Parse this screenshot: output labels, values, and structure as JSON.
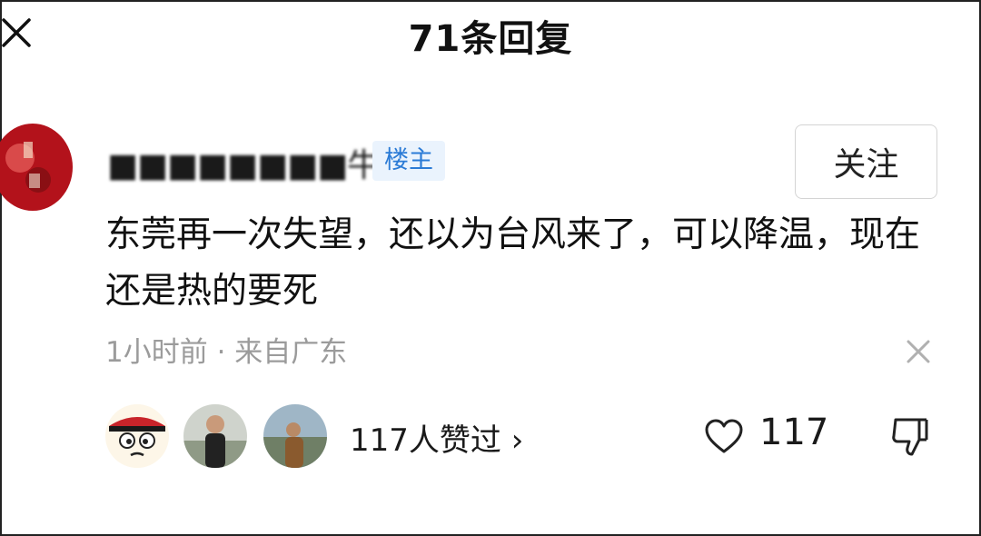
{
  "header": {
    "title": "71条回复",
    "close_icon": "close-icon"
  },
  "comment": {
    "username": "■■■■■■■■牛",
    "op_badge": "楼主",
    "follow_label": "关注",
    "text": "东莞再一次失望，还以为台风来了，可以降温，现在还是热的要死",
    "meta": "1小时前 · 来自广东",
    "likers_label": "117人赞过 ›",
    "like_count": "117"
  },
  "colors": {
    "badge_bg": "#eaf3fd",
    "badge_text": "#2b7bd6",
    "meta_text": "#9b9b9b"
  },
  "icons": {
    "dismiss": "close-icon",
    "like": "heart-icon",
    "dislike": "thumbs-down-icon"
  }
}
